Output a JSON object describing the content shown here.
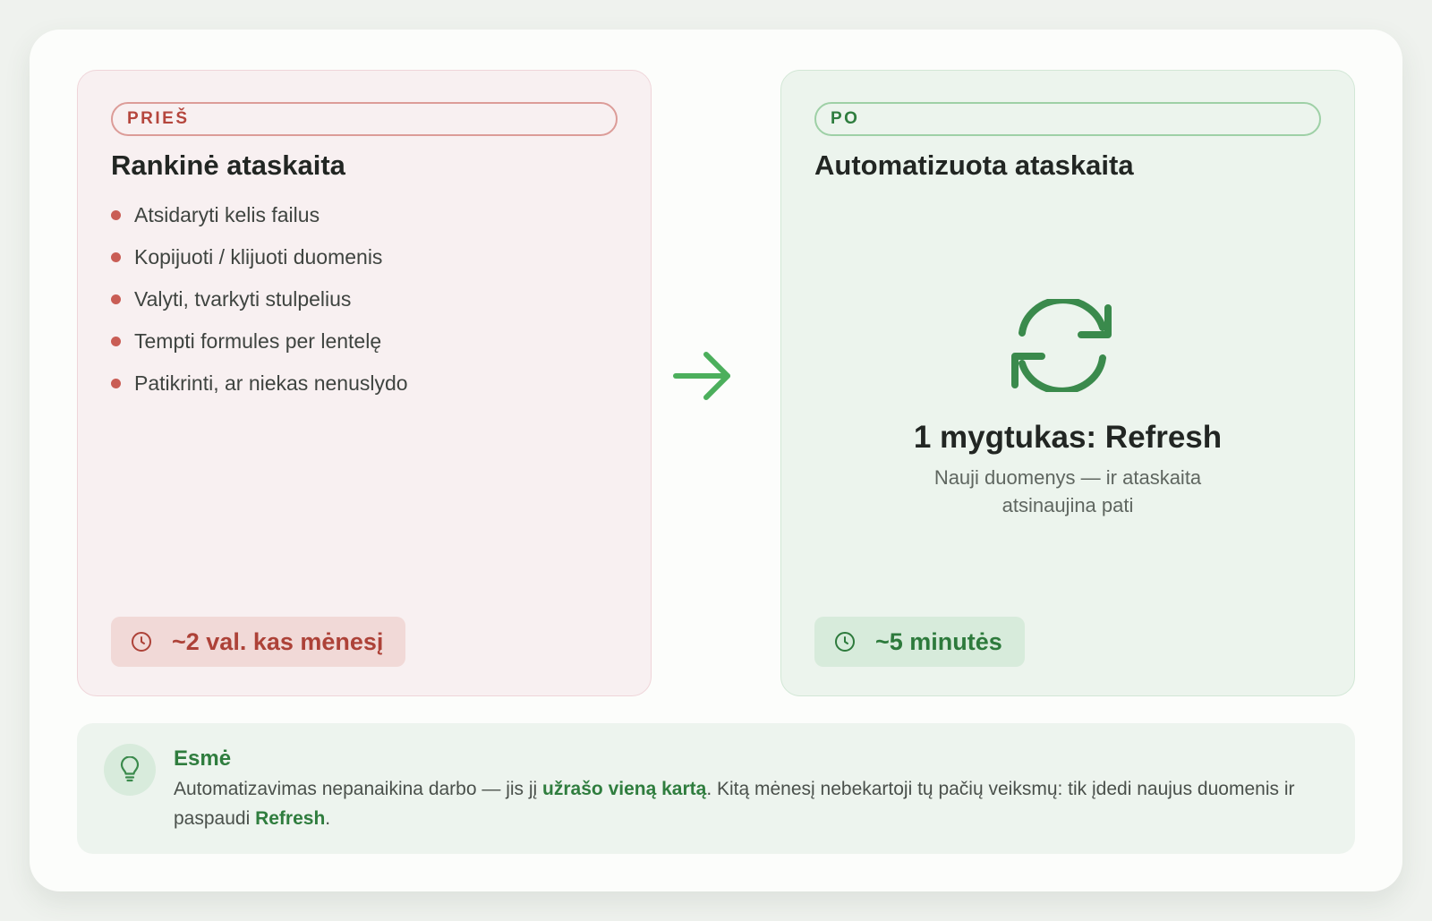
{
  "before": {
    "tag": "PRIEŠ",
    "title": "Rankinė ataskaita",
    "steps": [
      "Atsidaryti kelis failus",
      "Kopijuoti / klijuoti duomenis",
      "Valyti, tvarkyti stulpelius",
      "Tempti formules per lentelę",
      "Patikrinti, ar niekas nenuslydo"
    ],
    "time": "~2 val. kas mėnesį"
  },
  "after": {
    "tag": "PO",
    "title": "Automatizuota ataskaita",
    "headline": "1 mygtukas: Refresh",
    "subtitle_line1": "Nauji duomenys — ir ataskaita",
    "subtitle_line2": "atsinaujina pati",
    "time": "~5 minutės"
  },
  "note": {
    "title": "Esmė",
    "text_part1": "Automatizavimas nepanaikina darbo — jis jį ",
    "text_bold1": "užrašo vieną kartą",
    "text_part2": ". Kitą mėnesį nebekartoji tų pačių veiksmų: tik įdedi naujus duomenis ir paspaudi ",
    "text_bold2": "Refresh",
    "text_part3": "."
  },
  "colors": {
    "before_accent": "#c95d55",
    "after_accent": "#2f7d3e",
    "arrow": "#4caf5c"
  },
  "icons": {
    "before_badge": "clock-icon",
    "after_badge": "clock-icon",
    "center": "refresh-icon",
    "transition": "arrow-right-icon",
    "note": "lightbulb-icon"
  }
}
